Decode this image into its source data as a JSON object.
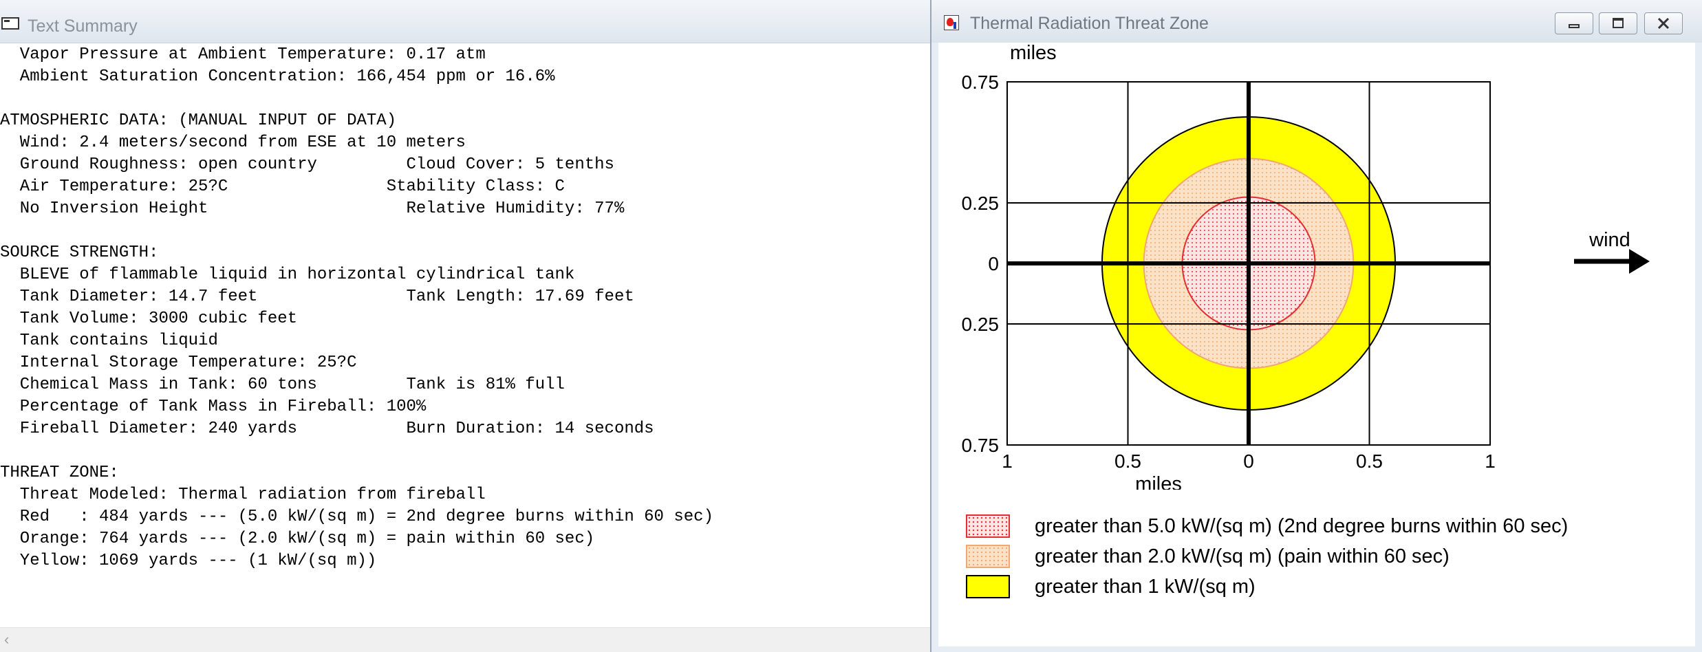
{
  "text_summary": {
    "title": "Text Summary",
    "lines": [
      "  Vapor Pressure at Ambient Temperature: 0.17 atm",
      "  Ambient Saturation Concentration: 166,454 ppm or 16.6%",
      "",
      "ATMOSPHERIC DATA: (MANUAL INPUT OF DATA)",
      "  Wind: 2.4 meters/second from ESE at 10 meters",
      "  Ground Roughness: open country         Cloud Cover: 5 tenths",
      "  Air Temperature: 25?C                Stability Class: C",
      "  No Inversion Height                    Relative Humidity: 77%",
      "",
      "SOURCE STRENGTH:",
      "  BLEVE of flammable liquid in horizontal cylindrical tank",
      "  Tank Diameter: 14.7 feet               Tank Length: 17.69 feet",
      "  Tank Volume: 3000 cubic feet",
      "  Tank contains liquid",
      "  Internal Storage Temperature: 25?C",
      "  Chemical Mass in Tank: 60 tons         Tank is 81% full",
      "  Percentage of Tank Mass in Fireball: 100%",
      "  Fireball Diameter: 240 yards           Burn Duration: 14 seconds",
      "",
      "THREAT ZONE:",
      "  Threat Modeled: Thermal radiation from fireball",
      "  Red   : 484 yards --- (5.0 kW/(sq m) = 2nd degree burns within 60 sec)",
      "  Orange: 764 yards --- (2.0 kW/(sq m) = pain within 60 sec)",
      "  Yellow: 1069 yards --- (1 kW/(sq m))"
    ]
  },
  "threat_window": {
    "title": "Thermal Radiation Threat Zone",
    "buttons": {
      "minimize_icon": "minimize-icon",
      "maximize_icon": "maximize-icon",
      "close_icon": "close-icon"
    },
    "wind_label": "wind",
    "legend": [
      {
        "label": "greater than 5.0 kW/(sq m) (2nd degree burns within 60 sec)",
        "fill": "#ffe4e4",
        "dots": "#e03030",
        "border": "#e03030"
      },
      {
        "label": "greater than 2.0 kW/(sq m) (pain within 60 sec)",
        "fill": "#fbe2c6",
        "dots": "#f0a870",
        "border": "#f0a870"
      },
      {
        "label": "greater than 1 kW/(sq m)",
        "fill": "#ffff00",
        "dots": "",
        "border": "#000000"
      }
    ]
  },
  "chart_data": {
    "type": "area",
    "ylabel": "miles",
    "xlabel": "miles",
    "xlim": [
      -1,
      1
    ],
    "ylim": [
      -0.75,
      0.75
    ],
    "x_ticks": [
      {
        "value": -1,
        "label": "1"
      },
      {
        "value": -0.5,
        "label": "0.5"
      },
      {
        "value": 0,
        "label": "0"
      },
      {
        "value": 0.5,
        "label": "0.5"
      },
      {
        "value": 1,
        "label": "1"
      }
    ],
    "y_ticks": [
      {
        "value": 0.75,
        "label": "0.75"
      },
      {
        "value": 0.25,
        "label": "0.25"
      },
      {
        "value": 0,
        "label": "0"
      },
      {
        "value": -0.25,
        "label": "0.25"
      },
      {
        "value": -0.75,
        "label": "0.75"
      }
    ],
    "grid": true,
    "zones": [
      {
        "name": "Yellow",
        "radius_miles": 0.607,
        "color": "#ffff00",
        "outline": "#000000"
      },
      {
        "name": "Orange",
        "radius_miles": 0.434,
        "color": "#fbe2c6",
        "outline": "#f0a870"
      },
      {
        "name": "Red",
        "radius_miles": 0.275,
        "color": "#ffe4e4",
        "outline": "#e03030"
      }
    ]
  }
}
